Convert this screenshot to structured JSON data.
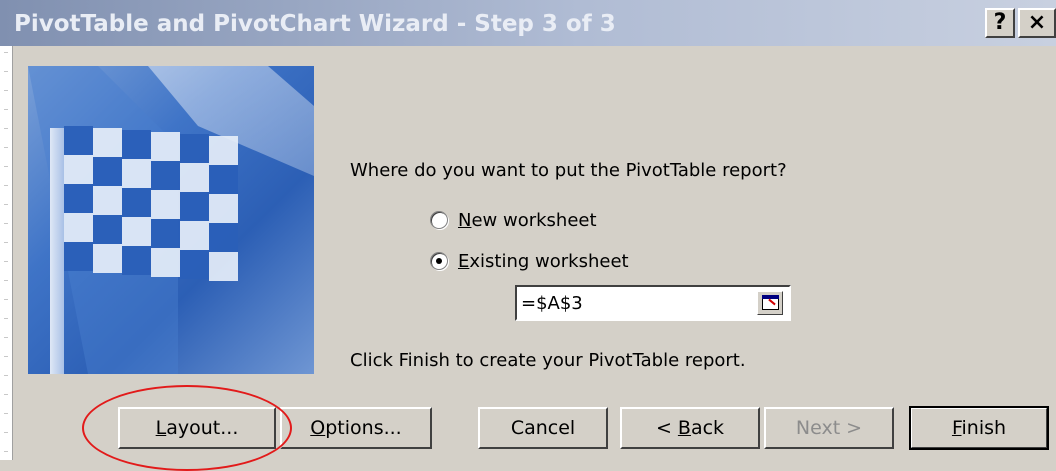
{
  "window": {
    "title": "PivotTable and PivotChart Wizard - Step 3 of 3",
    "help_label": "?",
    "close_label": "×"
  },
  "prompt": "Where do you want to put the PivotTable report?",
  "options": [
    {
      "prefix": "",
      "accel": "N",
      "suffix": "ew worksheet",
      "checked": false
    },
    {
      "prefix": "",
      "accel": "E",
      "suffix": "xisting worksheet",
      "checked": true
    }
  ],
  "reference_value": "=$A$3",
  "finish_note": "Click Finish to create your PivotTable report.",
  "buttons": {
    "layout": {
      "accel": "L",
      "rest": "ayout..."
    },
    "options": {
      "accel": "O",
      "rest": "ptions..."
    },
    "cancel": {
      "label": "Cancel"
    },
    "back": {
      "pre": "< ",
      "accel": "B",
      "rest": "ack"
    },
    "next": {
      "label": "Next >",
      "enabled": false
    },
    "finish": {
      "accel": "F",
      "rest": "inish"
    }
  },
  "colors": {
    "dialog_bg": "#d4d0c8",
    "title_gradient_start": "#8090b0",
    "highlight_annotation": "#e21a1a"
  }
}
